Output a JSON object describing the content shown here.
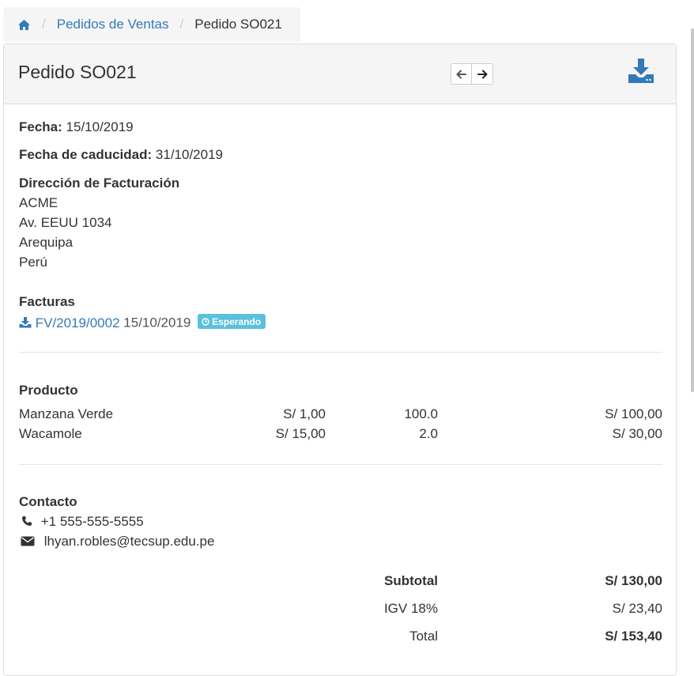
{
  "breadcrumb": {
    "home_icon": "home-icon",
    "sales_orders": "Pedidos de Ventas",
    "current": "Pedido SO021"
  },
  "header": {
    "title": "Pedido SO021",
    "prev_icon": "arrow-left-icon",
    "next_icon": "arrow-right-icon",
    "download_icon": "download-icon"
  },
  "order": {
    "date_label": "Fecha:",
    "date_value": "15/10/2019",
    "expiry_label": "Fecha de caducidad:",
    "expiry_value": "31/10/2019",
    "billing_label": "Dirección de Facturación",
    "billing_lines": [
      "ACME",
      "Av. EEUU 1034",
      "Arequipa",
      "Perú"
    ]
  },
  "invoices": {
    "label": "Facturas",
    "items": [
      {
        "number": "FV/2019/0002",
        "date": "15/10/2019",
        "status": "Esperando"
      }
    ]
  },
  "products": {
    "label": "Producto",
    "rows": [
      {
        "name": "Manzana Verde",
        "price": "S/ 1,00",
        "qty": "100.0",
        "total": "S/ 100,00"
      },
      {
        "name": "Wacamole",
        "price": "S/ 15,00",
        "qty": "2.0",
        "total": "S/ 30,00"
      }
    ]
  },
  "contact": {
    "label": "Contacto",
    "phone": "+1 555-555-5555",
    "email": "lhyan.robles@tecsup.edu.pe"
  },
  "totals": {
    "subtotal_label": "Subtotal",
    "subtotal_value": "S/ 130,00",
    "tax_label": "IGV 18%",
    "tax_value": "S/ 23,40",
    "total_label": "Total",
    "total_value": "S/ 153,40"
  },
  "colors": {
    "link": "#337ab7",
    "badge_info": "#5bc0de",
    "panel_heading": "#f5f5f5"
  }
}
